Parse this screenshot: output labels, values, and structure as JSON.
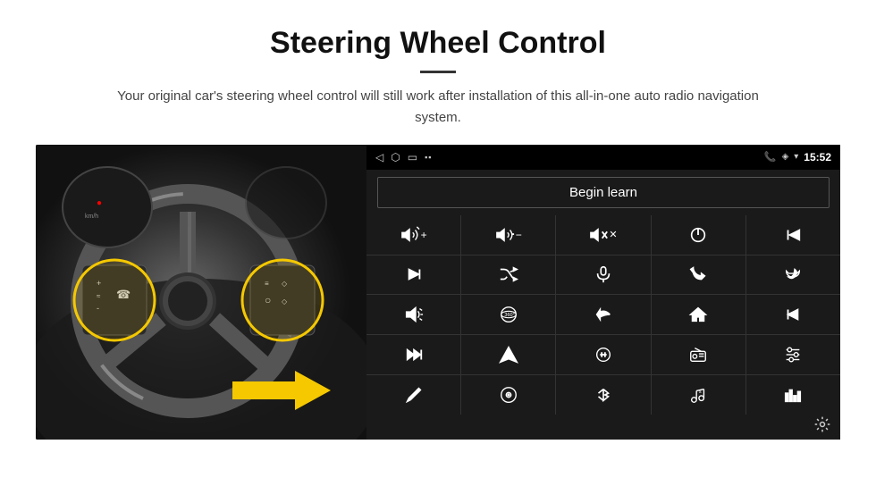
{
  "header": {
    "title": "Steering Wheel Control",
    "divider": true,
    "subtitle": "Your original car's steering wheel control will still work after installation of this all-in-one auto radio navigation system."
  },
  "status_bar": {
    "back_icon": "◁",
    "home_icon": "○",
    "recents_icon": "☐",
    "signal_icon": "▪▪",
    "phone_icon": "📞",
    "location_icon": "◈",
    "wifi_icon": "▾",
    "time": "15:52"
  },
  "begin_learn": {
    "label": "Begin learn"
  },
  "icons": [
    {
      "name": "vol-up",
      "symbol": "vol-up"
    },
    {
      "name": "vol-down",
      "symbol": "vol-down"
    },
    {
      "name": "vol-mute",
      "symbol": "vol-mute"
    },
    {
      "name": "power",
      "symbol": "power"
    },
    {
      "name": "prev-track",
      "symbol": "prev-track"
    },
    {
      "name": "next-track",
      "symbol": "next-track"
    },
    {
      "name": "shuffle",
      "symbol": "shuffle"
    },
    {
      "name": "mic",
      "symbol": "mic"
    },
    {
      "name": "phone",
      "symbol": "phone"
    },
    {
      "name": "hang-up",
      "symbol": "hang-up"
    },
    {
      "name": "horn",
      "symbol": "horn"
    },
    {
      "name": "360-view",
      "symbol": "360-view"
    },
    {
      "name": "back",
      "symbol": "back"
    },
    {
      "name": "home",
      "symbol": "home"
    },
    {
      "name": "skip-back",
      "symbol": "skip-back"
    },
    {
      "name": "fast-forward",
      "symbol": "fast-forward"
    },
    {
      "name": "nav",
      "symbol": "nav"
    },
    {
      "name": "eq",
      "symbol": "eq"
    },
    {
      "name": "radio",
      "symbol": "radio"
    },
    {
      "name": "settings-sliders",
      "symbol": "settings-sliders"
    },
    {
      "name": "edit",
      "symbol": "edit"
    },
    {
      "name": "disc",
      "symbol": "disc"
    },
    {
      "name": "bluetooth",
      "symbol": "bluetooth"
    },
    {
      "name": "music",
      "symbol": "music"
    },
    {
      "name": "equalizer",
      "symbol": "equalizer"
    }
  ],
  "settings_icon": "gear",
  "colors": {
    "background": "#fff",
    "panel_bg": "#1a1a1a",
    "icon_color": "#fff",
    "accent_yellow": "#f5c800"
  }
}
